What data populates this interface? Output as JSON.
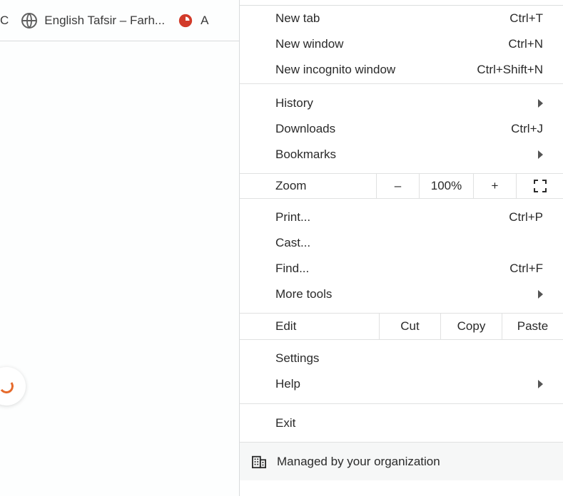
{
  "bookmarks_bar": {
    "first_fragment": "C",
    "item1_label": "English Tafsir – Farh...",
    "item2_label": "A"
  },
  "menu": {
    "new_tab": {
      "label": "New tab",
      "shortcut": "Ctrl+T"
    },
    "new_window": {
      "label": "New window",
      "shortcut": "Ctrl+N"
    },
    "new_incognito": {
      "label": "New incognito window",
      "shortcut": "Ctrl+Shift+N"
    },
    "history": {
      "label": "History"
    },
    "downloads": {
      "label": "Downloads",
      "shortcut": "Ctrl+J"
    },
    "bookmarks": {
      "label": "Bookmarks"
    },
    "zoom": {
      "label": "Zoom",
      "minus": "–",
      "value": "100%",
      "plus": "+"
    },
    "print": {
      "label": "Print...",
      "shortcut": "Ctrl+P"
    },
    "cast": {
      "label": "Cast..."
    },
    "find": {
      "label": "Find...",
      "shortcut": "Ctrl+F"
    },
    "more_tools": {
      "label": "More tools"
    },
    "edit": {
      "label": "Edit",
      "cut": "Cut",
      "copy": "Copy",
      "paste": "Paste"
    },
    "settings": {
      "label": "Settings"
    },
    "help": {
      "label": "Help"
    },
    "exit": {
      "label": "Exit"
    },
    "managed": {
      "label": "Managed by your organization"
    }
  }
}
